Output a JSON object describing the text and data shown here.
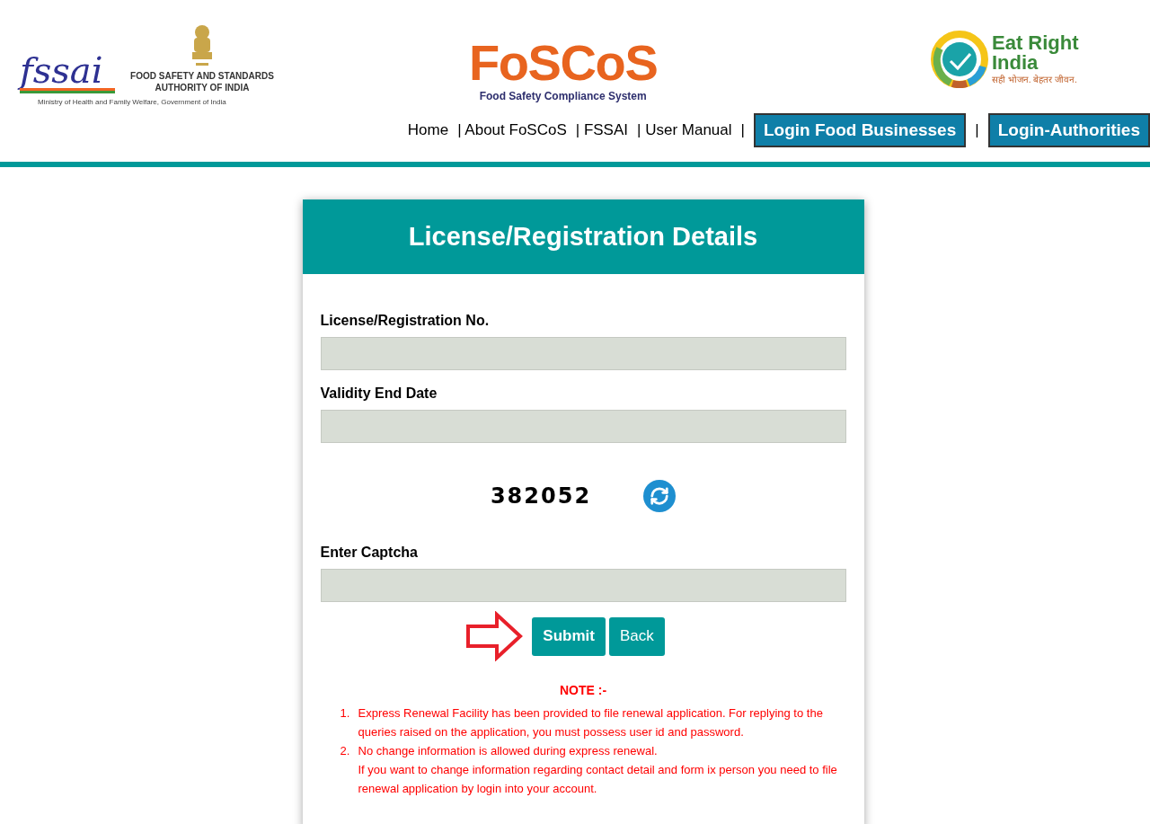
{
  "header": {
    "fssai_logo": "fssai",
    "authority_name": "FOOD SAFETY AND STANDARDS AUTHORITY OF INDIA",
    "ministry": "Ministry of Health and Family Welfare, Government of India",
    "foscos_logo": "FoSCoS",
    "foscos_subtitle": "Food Safety Compliance System",
    "eat_right_title": "Eat Right India",
    "eat_right_tagline": "सही भोजन. बेहतर जीवन."
  },
  "nav": [
    {
      "label": "Home",
      "kind": "link"
    },
    {
      "label": "| About FoSCoS",
      "kind": "link"
    },
    {
      "label": "| FSSAI",
      "kind": "link"
    },
    {
      "label": "| User Manual",
      "kind": "link"
    },
    {
      "label": "|",
      "kind": "separator"
    },
    {
      "label": "Login Food Businesses",
      "kind": "button"
    },
    {
      "label": "|",
      "kind": "separator"
    },
    {
      "label": "Login-Authorities",
      "kind": "button"
    }
  ],
  "form": {
    "title": "License/Registration Details",
    "fields": [
      {
        "label": "License/Registration No."
      },
      {
        "label": "Validity End Date"
      }
    ],
    "captcha": "382052",
    "captcha_field": {
      "label": "Enter Captcha"
    },
    "buttons": [
      {
        "label": "Submit",
        "bold": true
      },
      {
        "label": "Back",
        "bold": false
      }
    ],
    "note_title": "NOTE :-",
    "notes": [
      {
        "number": "1.",
        "lines": [
          "Express Renewal Facility has been provided to file renewal application. For replying to the queries raised on the application, you must possess user id and password."
        ]
      },
      {
        "number": "2.",
        "lines": [
          "No change information is allowed during express renewal.",
          "If you want to change information regarding contact detail and form ix person you need to file renewal application by login into your account."
        ]
      }
    ]
  }
}
